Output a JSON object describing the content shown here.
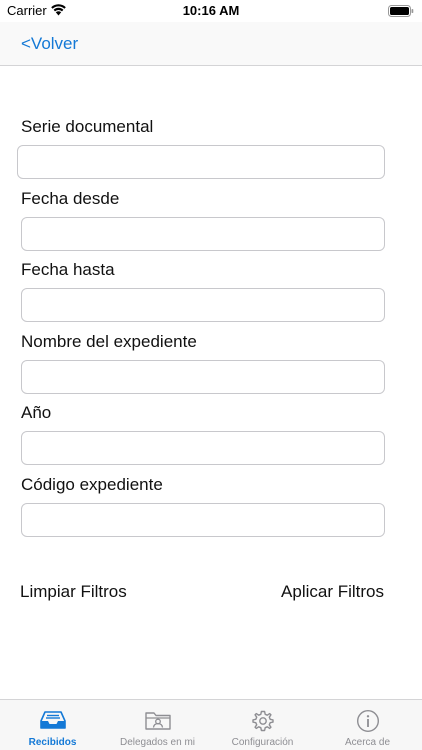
{
  "status_bar": {
    "carrier": "Carrier",
    "time": "10:16 AM"
  },
  "nav": {
    "back_label": "<Volver"
  },
  "form": {
    "fields": [
      {
        "label": "Serie documental",
        "value": ""
      },
      {
        "label": "Fecha desde",
        "value": ""
      },
      {
        "label": "Fecha hasta",
        "value": ""
      },
      {
        "label": "Nombre del expediente",
        "value": ""
      },
      {
        "label": "Año",
        "value": ""
      },
      {
        "label": "Código expediente",
        "value": ""
      }
    ],
    "clear_label": "Limpiar Filtros",
    "apply_label": "Aplicar Filtros"
  },
  "tabs": [
    {
      "label": "Recibidos",
      "icon": "inbox-tray-icon",
      "active": true
    },
    {
      "label": "Delegados en mi",
      "icon": "user-folder-icon",
      "active": false
    },
    {
      "label": "Configuración",
      "icon": "gear-icon",
      "active": false
    },
    {
      "label": "Acerca de",
      "icon": "info-icon",
      "active": false
    }
  ],
  "colors": {
    "accent": "#1479d6",
    "inactive": "#8e8e93"
  }
}
